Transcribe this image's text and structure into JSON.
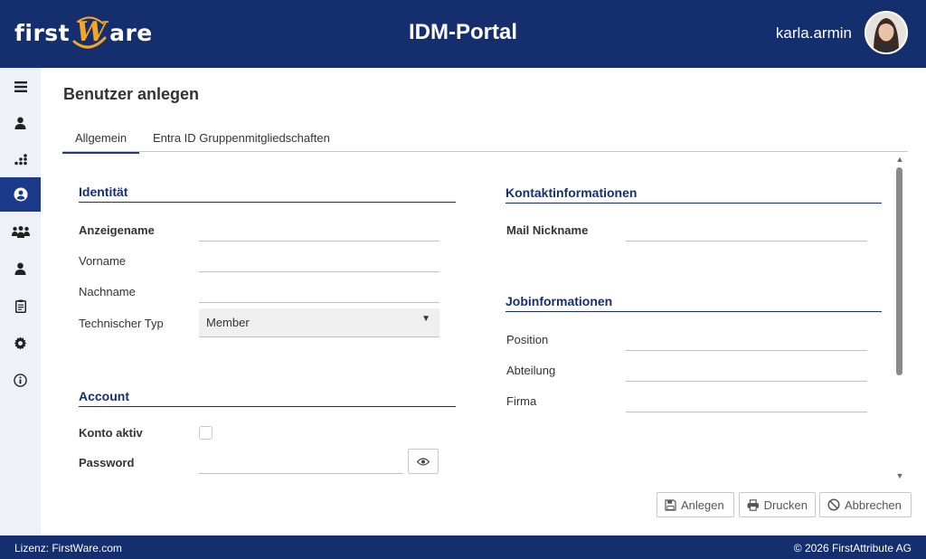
{
  "header": {
    "logo": {
      "first": "first",
      "w": "W",
      "rest": "are"
    },
    "title": "IDM-Portal",
    "username": "karla.armin"
  },
  "page": {
    "title": "Benutzer anlegen",
    "tabs": [
      {
        "label": "Allgemein",
        "active": true
      },
      {
        "label": "Entra ID Gruppenmitgliedschaften",
        "active": false
      }
    ]
  },
  "identity": {
    "title": "Identität",
    "display_name_label": "Anzeigename",
    "first_name_label": "Vorname",
    "last_name_label": "Nachname",
    "tech_type_label": "Technischer Typ",
    "tech_type_value": "Member"
  },
  "account": {
    "title": "Account",
    "active_label": "Konto aktiv",
    "password_label": "Password"
  },
  "contact": {
    "title": "Kontaktinformationen",
    "mail_nickname_label": "Mail Nickname"
  },
  "job": {
    "title": "Jobinformationen",
    "position_label": "Position",
    "department_label": "Abteilung",
    "company_label": "Firma"
  },
  "actions": {
    "create": "Anlegen",
    "print": "Drucken",
    "cancel": "Abbrechen"
  },
  "footer": {
    "license": "Lizenz: FirstWare.com",
    "copyright": "© 2026 FirstAttribute AG"
  },
  "colors": {
    "brand": "#152f6e",
    "accent": "#f5a623",
    "active_nav": "#1c3a8a"
  },
  "icons": [
    "menu-icon",
    "user-icon",
    "org-chart-icon",
    "user-circle-icon",
    "group-icon",
    "user-alt-icon",
    "clipboard-icon",
    "gear-icon",
    "info-icon",
    "eye-icon",
    "save-icon",
    "print-icon",
    "cancel-icon"
  ]
}
